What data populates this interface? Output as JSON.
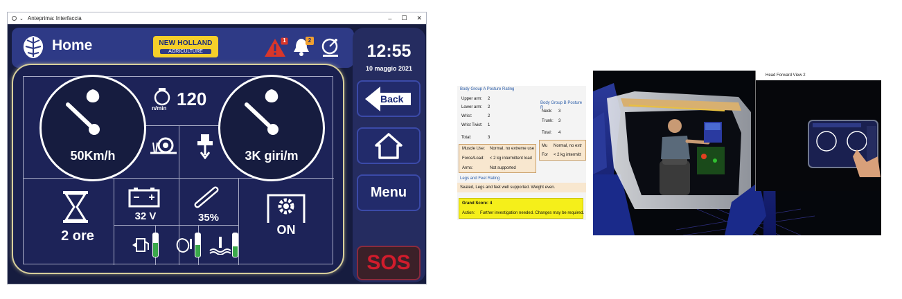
{
  "window": {
    "title": "Anteprima: Interfaccia",
    "controls": [
      "–",
      "☐",
      "✕"
    ]
  },
  "header": {
    "title": "Home",
    "brand_name": "NEW HOLLAND",
    "brand_sub": "AGRICULTURE",
    "warning_badge": "1",
    "bell_badge": "2"
  },
  "clock": {
    "time": "12:55",
    "date": "10 maggio 2021"
  },
  "sidebar": {
    "back_label": "Back",
    "menu_label": "Menu",
    "sos_label": "SOS"
  },
  "dashboard": {
    "speed": "50Km/h",
    "rpm_value": "120",
    "rpm_unit": "n/min",
    "engine_speed": "3K giri/m",
    "hours": "2 ore",
    "battery": "32 V",
    "load_percent": "35%",
    "service_status": "ON",
    "fuel_level": 0.6,
    "oil_level": 0.5,
    "coolant_level": 0.45
  },
  "posture_report": {
    "group_a_title": "Body Group A Posture Rating",
    "group_a_rows": [
      {
        "label": "Upper arm:",
        "value": "2"
      },
      {
        "label": "Lower arm:",
        "value": "2"
      },
      {
        "label": "Wrist:",
        "value": "2"
      },
      {
        "label": "Wrist Twist:",
        "value": "1"
      }
    ],
    "group_a_total_label": "Total:",
    "group_a_total": "3",
    "group_b_title": "Body Group B Posture R",
    "group_b_rows": [
      {
        "label": "Neck:",
        "value": "3"
      },
      {
        "label": "Trunk:",
        "value": "3"
      }
    ],
    "group_b_total_label": "Total:",
    "group_b_total": "4",
    "muscle_use_label": "Muscle Use:",
    "muscle_use_value": "Normal, no extreme use",
    "force_label": "Force/Load:",
    "force_value": "< 2 kg intermittent load",
    "arms_label": "Arms:",
    "arms_value": "Not supported",
    "b_mu_label": "Mu",
    "b_mu_value": "Normal, no extr",
    "b_for_label": "For",
    "b_for_value": "< 2 kg intermitt",
    "legs_title": "Legs and Feet Rating",
    "legs_text": "Seated, Legs and feet well supported.  Weight even.",
    "grand_score_label": "Grand Score:",
    "grand_score": "4",
    "action_label": "Action:",
    "action_text": "Further investigation needed.  Changes may be required."
  },
  "scene": {
    "inset_title": "Head Forward View 2"
  },
  "colors": {
    "window_bg": "#161c3f",
    "header_bg": "#2e3a86",
    "brand_yellow": "#f5cf2a",
    "alert_red": "#d9362a",
    "bell_badge": "#f0a030",
    "sos_red": "#d21c2c",
    "grand_score_yellow": "#f5ef1a"
  }
}
